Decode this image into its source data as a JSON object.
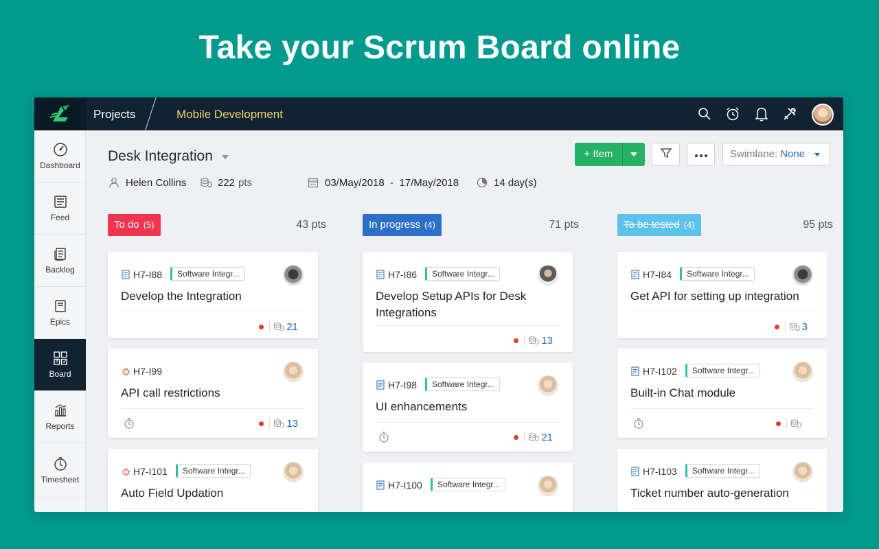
{
  "headline": "Take your Scrum Board online",
  "topbar": {
    "logo_icon": "zoho-sprints-logo",
    "projects_label": "Projects",
    "breadcrumb": "Mobile Development",
    "icons": [
      "search-icon",
      "timer-icon",
      "bell-icon",
      "tools-icon"
    ],
    "avatar": "user-avatar"
  },
  "sidebar": {
    "items": [
      {
        "label": "Dashboard",
        "icon": "gauge-icon"
      },
      {
        "label": "Feed",
        "icon": "feed-icon"
      },
      {
        "label": "Backlog",
        "icon": "backlog-icon"
      },
      {
        "label": "Epics",
        "icon": "epics-icon"
      },
      {
        "label": "Board",
        "icon": "board-icon",
        "active": true
      },
      {
        "label": "Reports",
        "icon": "reports-icon"
      },
      {
        "label": "Timesheet",
        "icon": "timesheet-icon"
      }
    ]
  },
  "header": {
    "title": "Desk Integration",
    "owner": "Helen Collins",
    "points": "222",
    "points_unit": "pts",
    "date_range": "03/May/2018  -  17/May/2018",
    "duration": "14 day(s)"
  },
  "toolbar": {
    "add_item_label": "+ Item",
    "filter_icon": "filter-icon",
    "more_icon": "more-icon",
    "swimlane_label": "Swimlane:",
    "swimlane_value": "None"
  },
  "colors": {
    "todo": "#f0334f",
    "in_progress": "#2c6fc9",
    "to_be_tested": "#5cc2ec",
    "accent_green": "#25b267",
    "topbar": "#112233",
    "background": "#019a8f"
  },
  "columns": [
    {
      "title": "To do",
      "count": "(5)",
      "points": "43 pts",
      "cards": [
        {
          "id": "H7-I88",
          "type": "story",
          "tag": "Software Integr...",
          "title": "Develop the Integration",
          "points": "21",
          "priority": "high",
          "timer": false
        },
        {
          "id": "H7-I99",
          "type": "bug",
          "tag": "",
          "title": "API call restrictions",
          "points": "13",
          "priority": "high",
          "timer": true
        },
        {
          "id": "H7-I101",
          "type": "bug",
          "tag": "Software Integr...",
          "title": "Auto Field Updation",
          "points": "",
          "priority": "",
          "timer": false
        }
      ]
    },
    {
      "title": "In progress",
      "count": "(4)",
      "points": "71 pts",
      "cards": [
        {
          "id": "H7-I86",
          "type": "story",
          "tag": "Software Integr...",
          "title": "Develop Setup APIs for Desk Integrations",
          "points": "13",
          "priority": "high",
          "timer": false
        },
        {
          "id": "H7-I98",
          "type": "story",
          "tag": "Software Integr...",
          "title": "UI enhancements",
          "points": "21",
          "priority": "high",
          "timer": true
        },
        {
          "id": "H7-I100",
          "type": "story",
          "tag": "Software Integr...",
          "title": "",
          "points": "",
          "priority": "",
          "timer": false
        }
      ]
    },
    {
      "title": "To be tested",
      "count": "(4)",
      "points": "95 pts",
      "cards": [
        {
          "id": "H7-I84",
          "type": "story",
          "tag": "Software Integr...",
          "title": "Get API for setting up integration",
          "points": "3",
          "priority": "high",
          "timer": false
        },
        {
          "id": "H7-I102",
          "type": "story",
          "tag": "Software Integr...",
          "title": "Built-in Chat module",
          "points": "",
          "priority": "high",
          "timer": true
        },
        {
          "id": "H7-I103",
          "type": "story",
          "tag": "Software Integr...",
          "title": "Ticket number auto-generation",
          "points": "",
          "priority": "",
          "timer": false
        }
      ]
    }
  ]
}
